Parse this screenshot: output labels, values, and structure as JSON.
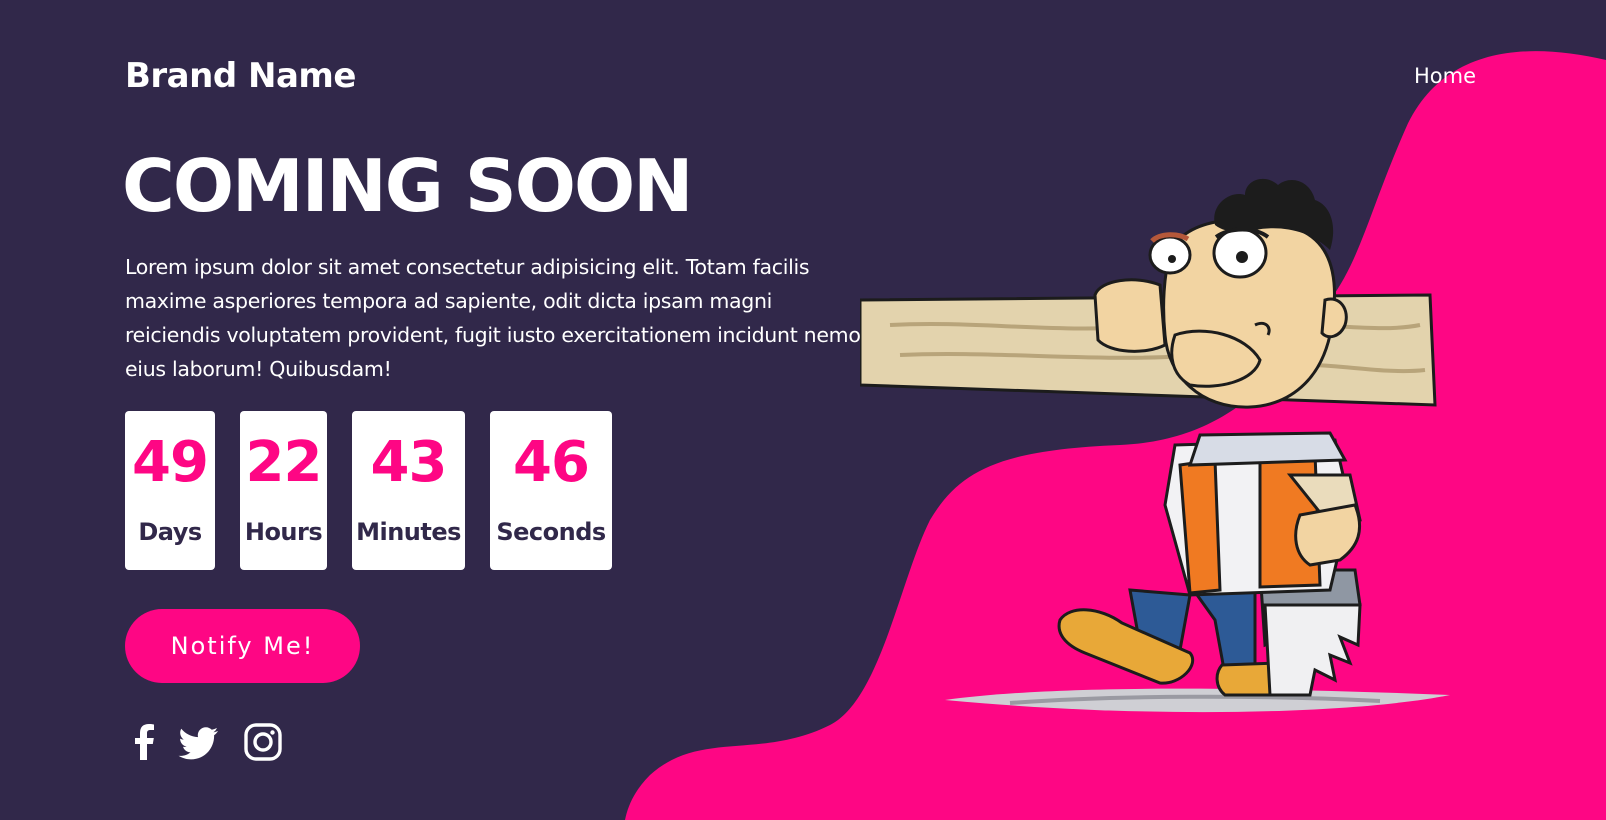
{
  "header": {
    "brand": "Brand Name",
    "nav_home": "Home"
  },
  "hero": {
    "title": "COMING SOON",
    "description": "Lorem ipsum dolor sit amet consectetur adipisicing elit. Totam facilis maxime asperiores tempora ad sapiente, odit dicta ipsam magni reiciendis voluptatem provident, fugit iusto exercitationem incidunt nemo, eius laborum! Quibusdam!"
  },
  "countdown": [
    {
      "value": "49",
      "label": "Days"
    },
    {
      "value": "22",
      "label": "Hours"
    },
    {
      "value": "43",
      "label": "Minutes"
    },
    {
      "value": "46",
      "label": "Seconds"
    }
  ],
  "cta": {
    "label": "Notify Me!"
  },
  "social": [
    {
      "icon": "facebook-icon"
    },
    {
      "icon": "twitter-icon"
    },
    {
      "icon": "instagram-icon"
    }
  ],
  "illustration": {
    "icon": "carpenter-illustration"
  },
  "colors": {
    "background": "#31284a",
    "accent": "#fe0684",
    "text": "#ffffff",
    "card": "#ffffff"
  }
}
